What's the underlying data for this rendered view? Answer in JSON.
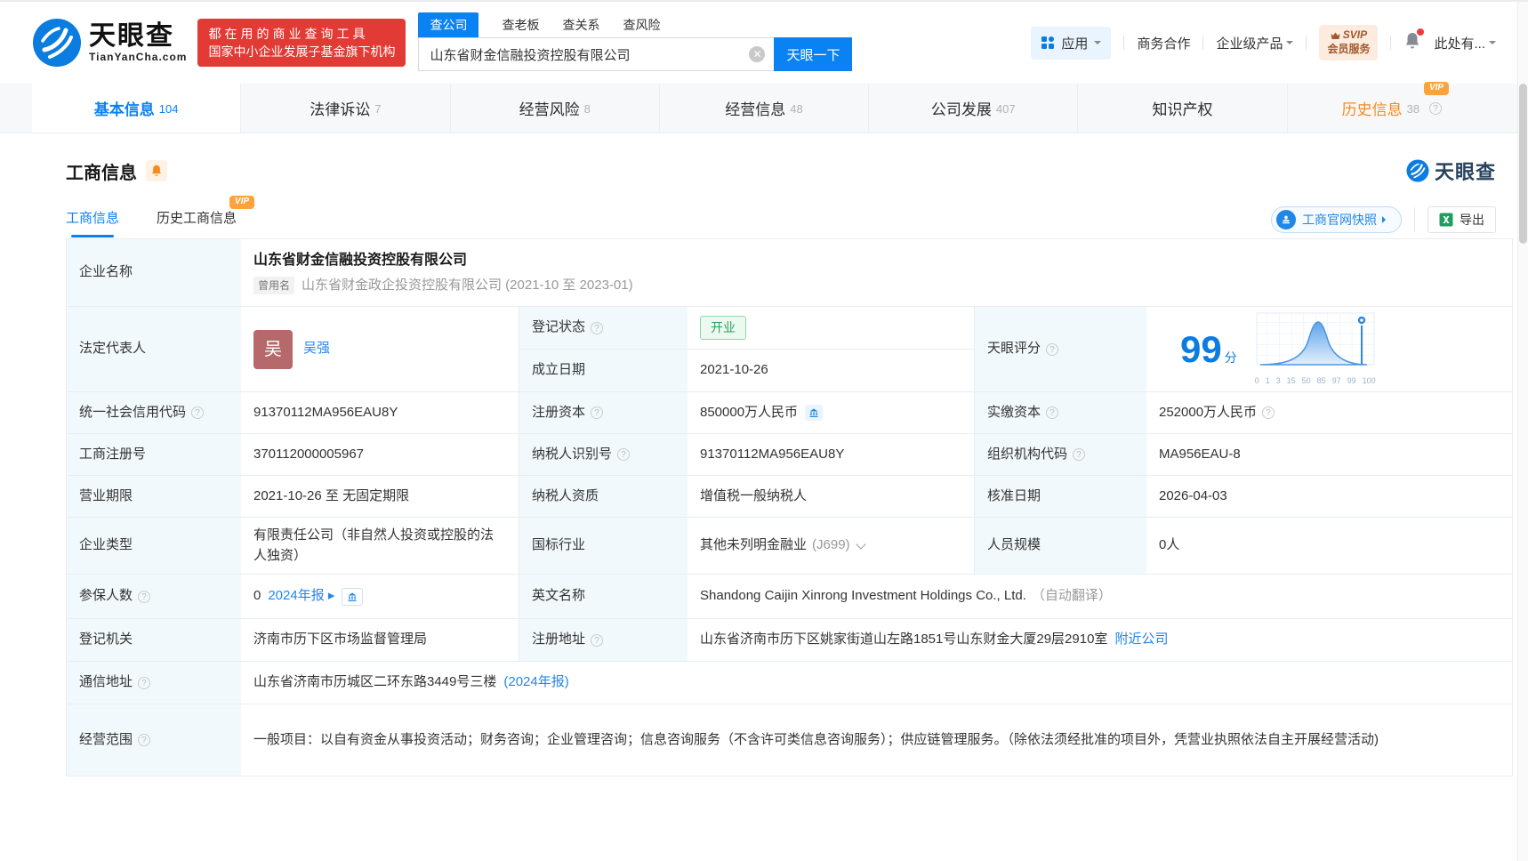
{
  "header": {
    "logo": {
      "brand": "天眼查",
      "domain": "TianYanCha.com"
    },
    "slogan_line1": "都在用的商业查询工具",
    "slogan_line2": "国家中小企业发展子基金旗下机构",
    "search": {
      "tabs": [
        {
          "label": "查公司",
          "active": true
        },
        {
          "label": "查老板",
          "active": false
        },
        {
          "label": "查关系",
          "active": false
        },
        {
          "label": "查风险",
          "active": false
        }
      ],
      "value": "山东省财金信融投资控股有限公司",
      "button": "天眼一下"
    },
    "nav": {
      "apps": "应用",
      "cooperation": "商务合作",
      "enterprise": "企业级产品",
      "svip_line1": "SVIP",
      "svip_line2": "会员服务",
      "user": "此处有..."
    }
  },
  "tabs": [
    {
      "label": "基本信息",
      "count": "104"
    },
    {
      "label": "法律诉讼",
      "count": "7"
    },
    {
      "label": "经营风险",
      "count": "8"
    },
    {
      "label": "经营信息",
      "count": "48"
    },
    {
      "label": "公司发展",
      "count": "407"
    },
    {
      "label": "知识产权",
      "count": ""
    },
    {
      "label": "历史信息",
      "count": "38",
      "vip": "VIP"
    }
  ],
  "section": {
    "title": "工商信息",
    "watermark": "天眼查",
    "subtabs": [
      {
        "label": "工商信息"
      },
      {
        "label": "历史工商信息",
        "vip": "VIP"
      }
    ],
    "snapshot_button": "工商官网快照",
    "export_button": "导出"
  },
  "company": {
    "name_label": "企业名称",
    "name": "山东省财金信融投资控股有限公司",
    "former_badge": "曾用名",
    "former_name": "山东省财金政企投资控股有限公司 (2021-10 至 2023-01)",
    "legal_rep_label": "法定代表人",
    "legal_rep_avatar": "吴",
    "legal_rep": "吴强",
    "status_label": "登记状态",
    "status": "开业",
    "established_label": "成立日期",
    "established": "2021-10-26",
    "score_label": "天眼评分",
    "score": "99",
    "score_unit": "分",
    "score_ticks": [
      "0",
      "1",
      "3",
      "15",
      "50",
      "85",
      "97",
      "99",
      "100"
    ],
    "credit_code_label": "统一社会信用代码",
    "credit_code": "91370112MA956EAU8Y",
    "reg_capital_label": "注册资本",
    "reg_capital": "850000万人民币",
    "paid_capital_label": "实缴资本",
    "paid_capital": "252000万人民币",
    "reg_number_label": "工商注册号",
    "reg_number": "370112000005967",
    "taxpayer_id_label": "纳税人识别号",
    "taxpayer_id": "91370112MA956EAU8Y",
    "org_code_label": "组织机构代码",
    "org_code": "MA956EAU-8",
    "term_label": "营业期限",
    "term": "2021-10-26 至 无固定期限",
    "taxpayer_quality_label": "纳税人资质",
    "taxpayer_quality": "增值税一般纳税人",
    "approval_date_label": "核准日期",
    "approval_date": "2026-04-03",
    "company_type_label": "企业类型",
    "company_type": "有限责任公司（非自然人投资或控股的法人独资）",
    "industry_label": "国标行业",
    "industry": "其他未列明金融业",
    "industry_code": "(J699)",
    "staff_size_label": "人员规模",
    "staff_size": "0人",
    "insured_label": "参保人数",
    "insured": "0",
    "insured_report": "2024年报",
    "english_name_label": "英文名称",
    "english_name": "Shandong Caijin Xinrong Investment Holdings Co., Ltd.",
    "english_name_note": "（自动翻译）",
    "registry_label": "登记机关",
    "registry": "济南市历下区市场监督管理局",
    "address_label": "注册地址",
    "address": "山东省济南市历下区姚家街道山左路1851号山东财金大厦29层2910室",
    "address_link": "附近公司",
    "mail_address_label": "通信地址",
    "mail_address": "山东省济南市历城区二环东路3449号三楼",
    "mail_address_link": "(2024年报)",
    "scope_label": "经营范围",
    "scope": "一般项目：以自有资金从事投资活动；财务咨询；企业管理咨询；信息咨询服务（不含许可类信息咨询服务）；供应链管理服务。（除依法须经批准的项目外，凭营业执照依法自主开展经营活动)"
  },
  "colors": {
    "accent_blue": "#0b82f1",
    "brand_red": "#e23a34",
    "vip_orange": "#ffa23d",
    "status_green": "#2aa15f",
    "label_bg": "#f2f9fc"
  }
}
